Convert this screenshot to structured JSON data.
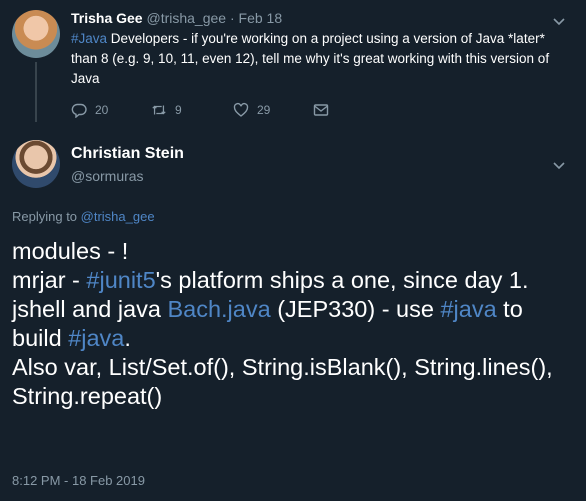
{
  "parent_tweet": {
    "name": "Trisha Gee",
    "handle": "@trisha_gee",
    "separator": "·",
    "date": "Feb 18",
    "hashtag": "#Java",
    "text_1": " Developers - if you're working on a project using a version of Java *later* than 8 (e.g. 9, 10, 11, even 12), tell me why it's great working with this version of Java",
    "replies": "20",
    "retweets": "9",
    "likes": "29"
  },
  "main_tweet": {
    "name": "Christian Stein",
    "handle": "@sormuras",
    "replying_label": "Replying to ",
    "replying_handle": "@trisha_gee",
    "line1": "modules - !",
    "line2_pre": "mrjar - ",
    "line2_tag": "#junit5",
    "line2_post": "'s platform ships a one, since day 1.",
    "line3_pre": "jshell and java ",
    "line3_link": "Bach.java",
    "line3_mid": " (JEP330) - use ",
    "line3_tag": "#java",
    "line3_post": " to build ",
    "line3_tag2": "#java",
    "line3_end": ".",
    "line4": "Also var, List/Set.of(), String.isBlank(), String.lines(), String.repeat()",
    "timestamp": "8:12 PM - 18 Feb 2019"
  },
  "colors": {
    "background": "#15202b",
    "link": "#4f86c6",
    "muted": "#8899a6",
    "text": "#ffffff"
  },
  "icons": [
    "reply-icon",
    "retweet-icon",
    "like-icon",
    "dm-icon",
    "chevron-down-icon"
  ]
}
